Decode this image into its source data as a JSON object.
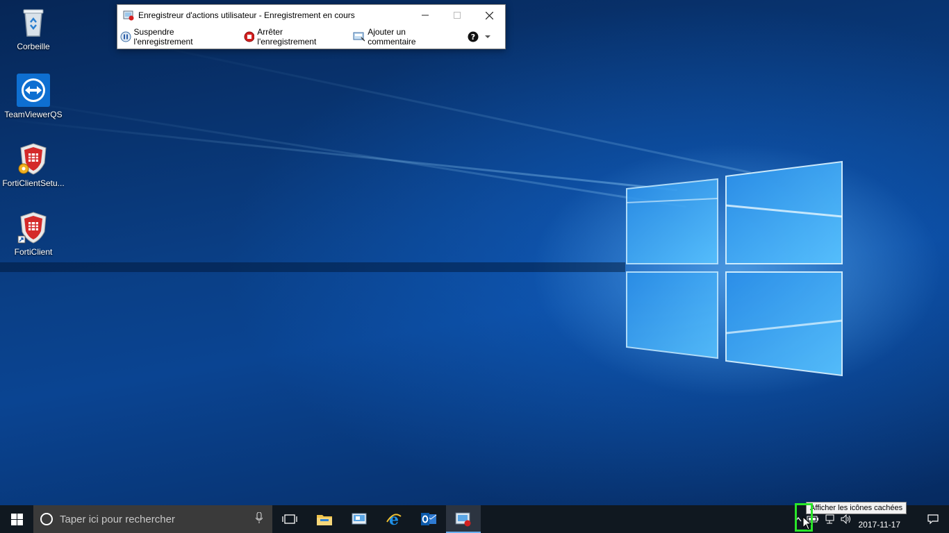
{
  "desktop": {
    "icons": [
      {
        "label": "Corbeille",
        "icon": "recycle-bin-icon"
      },
      {
        "label": "TeamViewerQS",
        "icon": "teamviewer-icon"
      },
      {
        "label": "FortiClientSetu...",
        "icon": "forticlient-setup-icon"
      },
      {
        "label": "FortiClient",
        "icon": "forticlient-icon"
      }
    ]
  },
  "recorder": {
    "title": "Enregistreur d'actions utilisateur - Enregistrement en cours",
    "pause_label": "Suspendre l'enregistrement",
    "stop_label": "Arrêter l'enregistrement",
    "comment_label": "Ajouter un commentaire",
    "help_icon": "help-icon"
  },
  "taskbar": {
    "search_placeholder": "Taper ici pour rechercher",
    "apps": [
      "task-view-icon",
      "file-explorer-icon",
      "control-panel-icon",
      "internet-explorer-icon",
      "outlook-icon",
      "steps-recorder-icon"
    ],
    "tooltip": "Afficher les icônes cachées",
    "date": "2017-11-17"
  },
  "colors": {
    "highlight": "#29e629",
    "accent": "#0078d7"
  }
}
